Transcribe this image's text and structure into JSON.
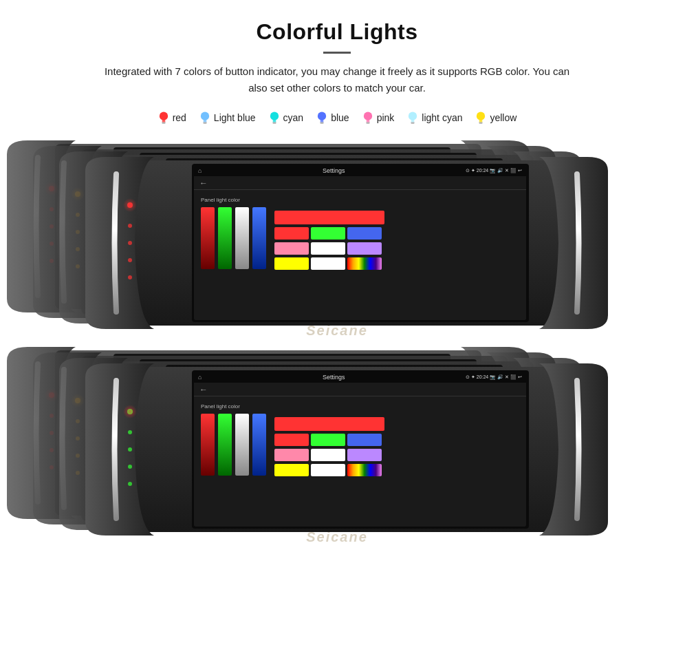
{
  "header": {
    "title": "Colorful Lights",
    "description": "Integrated with 7 colors of button indicator, you may change it freely as it supports RGB color. You can also set other colors to match your car."
  },
  "colors": [
    {
      "name": "red",
      "color": "#FF2222",
      "type": "filled"
    },
    {
      "name": "Light blue",
      "color": "#66BBFF",
      "type": "outline"
    },
    {
      "name": "cyan",
      "color": "#00DDDD",
      "type": "outline"
    },
    {
      "name": "blue",
      "color": "#4466FF",
      "type": "outline"
    },
    {
      "name": "pink",
      "color": "#FF66AA",
      "type": "filled"
    },
    {
      "name": "light cyan",
      "color": "#AAEEFF",
      "type": "outline"
    },
    {
      "name": "yellow",
      "color": "#FFDD00",
      "type": "outline"
    }
  ],
  "screen": {
    "status_time": "20:24",
    "nav_title": "Settings",
    "panel_label": "Panel light color",
    "bars": [
      {
        "color": "#FF3333"
      },
      {
        "color": "#33FF33"
      },
      {
        "color": "#FFFFFF"
      },
      {
        "color": "#4477FF"
      }
    ],
    "swatches_row1": [
      "#FF3333",
      "#33FF33",
      "#4477FF"
    ],
    "swatches_row2": [
      "#FF88AA",
      "#FFFFFF",
      "#BB88FF"
    ],
    "swatches_row3": [
      "#FFFF00",
      "#FFFFFF",
      "#FF44FF"
    ]
  },
  "watermark": "Seicane",
  "units_top": {
    "count": 4,
    "light_colors": [
      "#FF3333",
      "#FFAA00",
      "#FF00FF",
      "#FF3333"
    ]
  },
  "units_bottom": {
    "count": 4,
    "light_colors": [
      "#FF3333",
      "#FFAA00",
      "#FFFF00",
      "#33FF33"
    ]
  }
}
